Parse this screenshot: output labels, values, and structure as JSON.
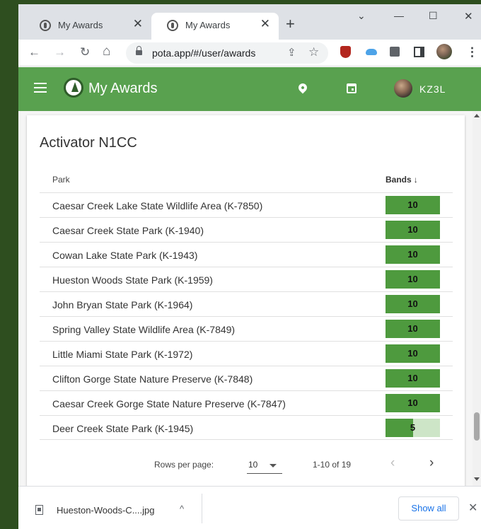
{
  "browser": {
    "tabs": [
      {
        "title": "My Awards",
        "close": "✕"
      },
      {
        "title": "My Awards",
        "close": "✕"
      }
    ],
    "new_tab": "+",
    "window_controls": {
      "dropdown": "⌄",
      "minimize": "—",
      "maximize": "☐",
      "close": "✕"
    },
    "url": "pota.app/#/user/awards",
    "nav": {
      "back": "←",
      "forward": "→",
      "reload": "↻",
      "home": "⌂"
    },
    "omnibox_icons": {
      "share": "⇪",
      "bookmark": "☆"
    },
    "extension_icons": [
      "ublock-icon",
      "cloud-icon",
      "puzzle-icon",
      "sidepanel-icon",
      "profile-icon"
    ],
    "menu": "⋮"
  },
  "appbar": {
    "title": "My Awards",
    "username": "KZ3L",
    "icons": [
      "menu-icon",
      "pota-logo",
      "location-pin-icon",
      "calendar-icon",
      "avatar"
    ],
    "color": "#59a14f"
  },
  "card": {
    "title": "Activator N1CC",
    "columns": {
      "park": "Park",
      "bands": "Bands",
      "sort_arrow": "↓"
    },
    "rows": [
      {
        "park": "Caesar Creek Lake State Wildlife Area (K-7850)",
        "bands": "10",
        "fill": 1.0
      },
      {
        "park": "Caesar Creek State Park (K-1940)",
        "bands": "10",
        "fill": 1.0
      },
      {
        "park": "Cowan Lake State Park (K-1943)",
        "bands": "10",
        "fill": 1.0
      },
      {
        "park": "Hueston Woods State Park (K-1959)",
        "bands": "10",
        "fill": 1.0
      },
      {
        "park": "John Bryan State Park (K-1964)",
        "bands": "10",
        "fill": 1.0
      },
      {
        "park": "Spring Valley State Wildlife Area (K-7849)",
        "bands": "10",
        "fill": 1.0
      },
      {
        "park": "Little Miami State Park (K-1972)",
        "bands": "10",
        "fill": 1.0
      },
      {
        "park": "Clifton Gorge State Nature Preserve (K-7848)",
        "bands": "10",
        "fill": 1.0
      },
      {
        "park": "Caesar Creek Gorge State Nature Preserve (K-7847)",
        "bands": "10",
        "fill": 1.0
      },
      {
        "park": "Deer Creek State Park (K-1945)",
        "bands": "5",
        "fill": 0.5
      }
    ],
    "pagination": {
      "rows_per_page_label": "Rows per page:",
      "rows_per_page": "10",
      "range": "1-10 of 19",
      "prev": "‹",
      "next": "›"
    },
    "bar_colors": {
      "fill": "#4e9a3e",
      "track": "#cde5c7"
    }
  },
  "downloads": {
    "filename": "Hueston-Woods-C....jpg",
    "caret": "^",
    "show_all": "Show all",
    "close": "✕"
  }
}
